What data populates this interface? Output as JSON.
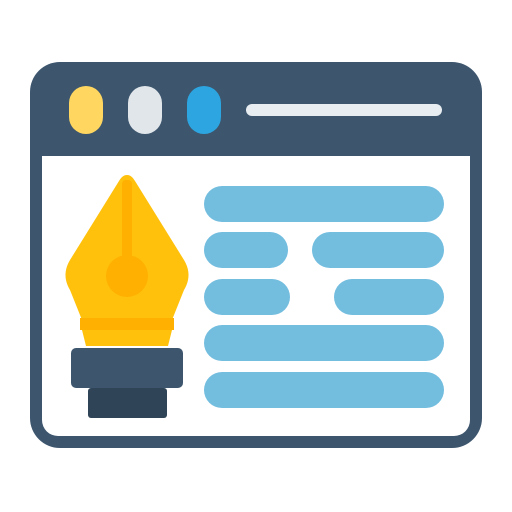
{
  "icon": {
    "name": "web-design-pen-icon",
    "colors": {
      "frame": "#3d566e",
      "frame_dark": "#2f4456",
      "canvas": "#ffffff",
      "dot_yellow": "#ffd760",
      "dot_grey": "#e1e6ea",
      "dot_blue": "#2da5e0",
      "address_bar": "#e8edf1",
      "text_lines": "#73bddf",
      "pen_light": "#ffc10c",
      "pen_dark": "#ffb000"
    },
    "window_controls": [
      "yellow-dot",
      "grey-dot",
      "blue-dot"
    ],
    "content_lines": 7
  }
}
